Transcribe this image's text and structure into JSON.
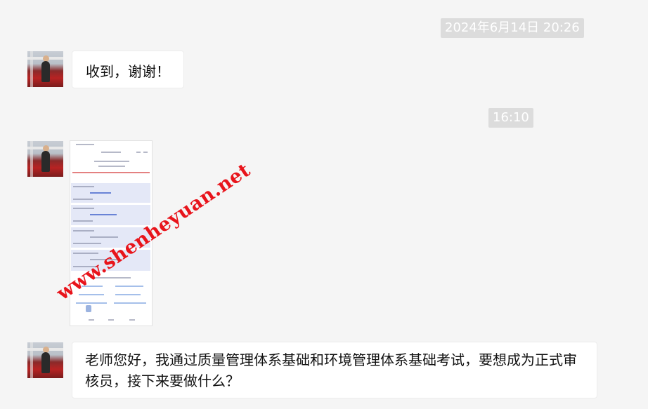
{
  "chat": {
    "timestamp_1": "2024年6月14日 20:26",
    "timestamp_2": "16:10",
    "messages": [
      {
        "sender": "user",
        "type": "text",
        "text": "收到，谢谢！"
      },
      {
        "sender": "user",
        "type": "image",
        "icon": "screenshot-thumbnail"
      },
      {
        "sender": "user",
        "type": "text",
        "text": "老师您好，我通过质量管理体系基础和环境管理体系基础考试，要想成为正式审核员，接下来要做什么？"
      }
    ]
  },
  "watermark": {
    "text": "www.shenheyuan.net",
    "color": "#e8141b"
  },
  "colors": {
    "background": "#f5f5f5",
    "bubble": "#ffffff",
    "timestamp_bg": "#dcdcdc"
  }
}
